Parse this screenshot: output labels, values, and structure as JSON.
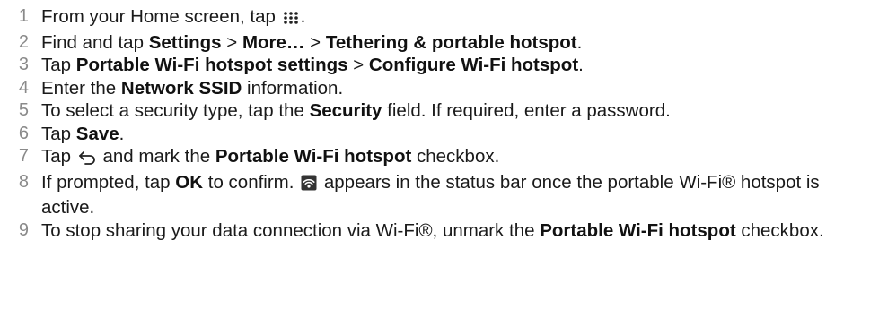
{
  "steps": [
    {
      "num": "1",
      "t1": "From your Home screen, tap",
      "t2": "."
    },
    {
      "num": "2",
      "t1": "Find and tap",
      "b1": "Settings",
      "t2": ">",
      "b2": "More…",
      "t3": ">",
      "b3": "Tethering & portable hotspot",
      "t4": "."
    },
    {
      "num": "3",
      "t1": "Tap",
      "b1": "Portable Wi-Fi hotspot settings",
      "t2": ">",
      "b2": "Configure Wi-Fi hotspot",
      "t3": "."
    },
    {
      "num": "4",
      "t1": "Enter the",
      "b1": "Network SSID",
      "t2": "information."
    },
    {
      "num": "5",
      "t1": "To select a security type, tap the",
      "b1": "Security",
      "t2": "field. If required, enter a password."
    },
    {
      "num": "6",
      "t1": "Tap",
      "b1": "Save",
      "t2": "."
    },
    {
      "num": "7",
      "t1": "Tap",
      "t2": "and mark the",
      "b1": "Portable Wi-Fi hotspot",
      "t3": "checkbox."
    },
    {
      "num": "8",
      "t1": "If prompted, tap",
      "b1": "OK",
      "t2": "to confirm.",
      "t3": "appears in the status bar once the portable Wi-Fi® hotspot is active."
    },
    {
      "num": "9",
      "t1": "To stop sharing your data connection via Wi-Fi®, unmark the",
      "b1": "Portable Wi-Fi hotspot",
      "t2": "checkbox."
    }
  ],
  "icons": {
    "apps": "apps-grid-icon",
    "back": "back-arrow-icon",
    "hotspot": "wifi-hotspot-icon"
  }
}
